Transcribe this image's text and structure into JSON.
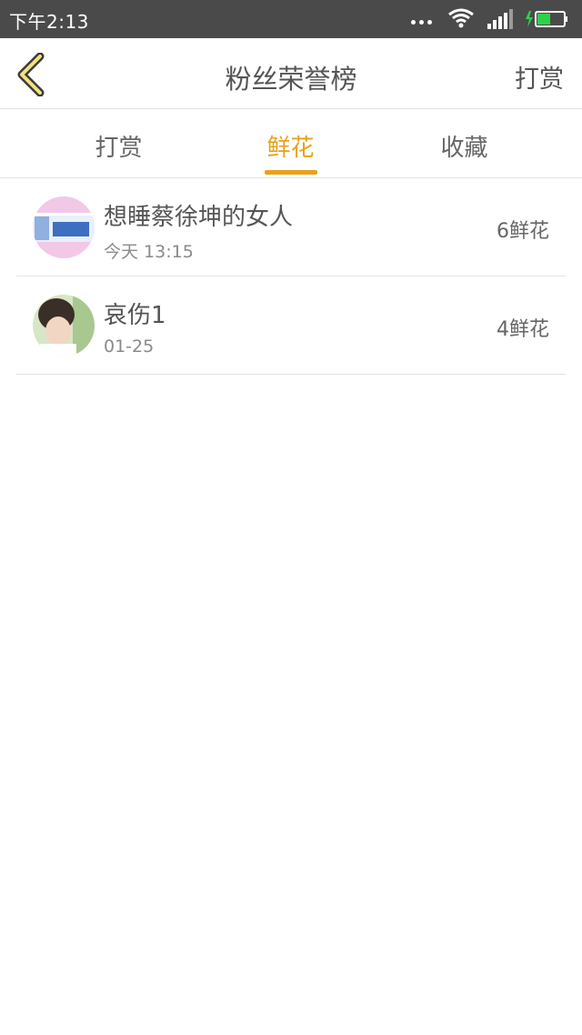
{
  "status_bar": {
    "time": "下午2:13",
    "icons": [
      "more-dots-icon",
      "wifi-icon",
      "signal-icon",
      "charging-icon",
      "battery-icon"
    ]
  },
  "header": {
    "title": "粉丝荣誉榜",
    "action": "打赏",
    "back_icon": "chevron-left-icon"
  },
  "tabs": [
    {
      "label": "打赏",
      "active": false
    },
    {
      "label": "鲜花",
      "active": true
    },
    {
      "label": "收藏",
      "active": false
    }
  ],
  "colors": {
    "accent": "#e9a11a",
    "status_bar": "#4a4a4a",
    "text_primary": "#555555",
    "text_secondary": "#8a8a8a",
    "divider": "#e3e3e3"
  },
  "fans": [
    {
      "name": "想睡蔡徐坤的女人",
      "time": "今天 13:15",
      "count": "6鲜花"
    },
    {
      "name": "哀伤1",
      "time": "01-25",
      "count": "4鲜花"
    }
  ]
}
